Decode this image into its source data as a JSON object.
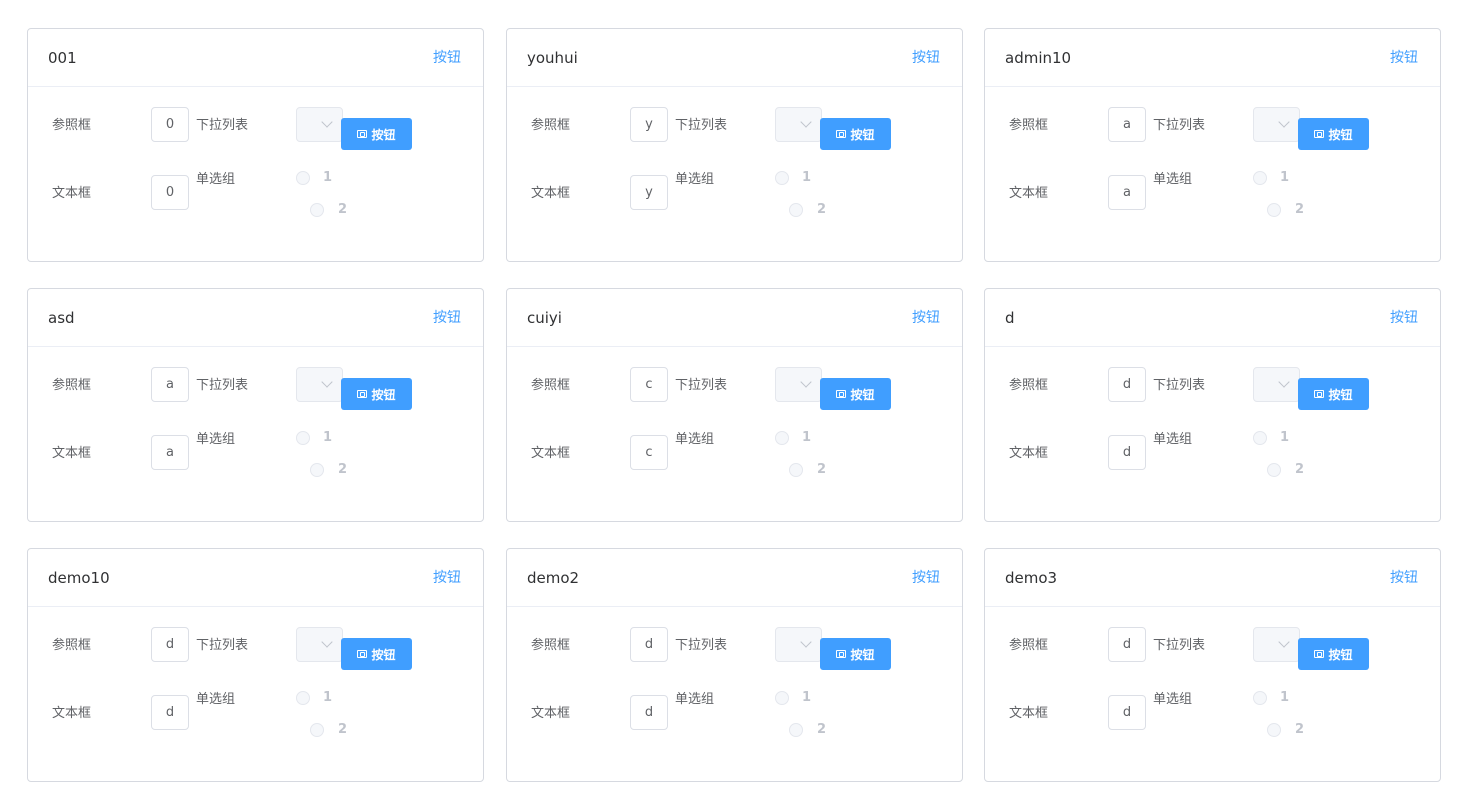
{
  "colors": {
    "accent": "#409eff",
    "border": "#d6d9e0",
    "muted": "#c0c4cc"
  },
  "cards": [
    {
      "title": "001",
      "header_button": "按钮",
      "ref_label": "参照框",
      "ref_value": "0",
      "select_label": "下拉列表",
      "select_value": "",
      "action_button": "按钮",
      "text_label": "文本框",
      "text_value": "0",
      "radio_label": "单选组",
      "radio_options": [
        "1",
        "2"
      ]
    },
    {
      "title": "youhui",
      "header_button": "按钮",
      "ref_label": "参照框",
      "ref_value": "y",
      "select_label": "下拉列表",
      "select_value": "",
      "action_button": "按钮",
      "text_label": "文本框",
      "text_value": "y",
      "radio_label": "单选组",
      "radio_options": [
        "1",
        "2"
      ]
    },
    {
      "title": "admin10",
      "header_button": "按钮",
      "ref_label": "参照框",
      "ref_value": "a",
      "select_label": "下拉列表",
      "select_value": "",
      "action_button": "按钮",
      "text_label": "文本框",
      "text_value": "a",
      "radio_label": "单选组",
      "radio_options": [
        "1",
        "2"
      ]
    },
    {
      "title": "asd",
      "header_button": "按钮",
      "ref_label": "参照框",
      "ref_value": "a",
      "select_label": "下拉列表",
      "select_value": "",
      "action_button": "按钮",
      "text_label": "文本框",
      "text_value": "a",
      "radio_label": "单选组",
      "radio_options": [
        "1",
        "2"
      ]
    },
    {
      "title": "cuiyi",
      "header_button": "按钮",
      "ref_label": "参照框",
      "ref_value": "c",
      "select_label": "下拉列表",
      "select_value": "",
      "action_button": "按钮",
      "text_label": "文本框",
      "text_value": "c",
      "radio_label": "单选组",
      "radio_options": [
        "1",
        "2"
      ]
    },
    {
      "title": "d",
      "header_button": "按钮",
      "ref_label": "参照框",
      "ref_value": "d",
      "select_label": "下拉列表",
      "select_value": "",
      "action_button": "按钮",
      "text_label": "文本框",
      "text_value": "d",
      "radio_label": "单选组",
      "radio_options": [
        "1",
        "2"
      ]
    },
    {
      "title": "demo10",
      "header_button": "按钮",
      "ref_label": "参照框",
      "ref_value": "d",
      "select_label": "下拉列表",
      "select_value": "",
      "action_button": "按钮",
      "text_label": "文本框",
      "text_value": "d",
      "radio_label": "单选组",
      "radio_options": [
        "1",
        "2"
      ]
    },
    {
      "title": "demo2",
      "header_button": "按钮",
      "ref_label": "参照框",
      "ref_value": "d",
      "select_label": "下拉列表",
      "select_value": "",
      "action_button": "按钮",
      "text_label": "文本框",
      "text_value": "d",
      "radio_label": "单选组",
      "radio_options": [
        "1",
        "2"
      ]
    },
    {
      "title": "demo3",
      "header_button": "按钮",
      "ref_label": "参照框",
      "ref_value": "d",
      "select_label": "下拉列表",
      "select_value": "",
      "action_button": "按钮",
      "text_label": "文本框",
      "text_value": "d",
      "radio_label": "单选组",
      "radio_options": [
        "1",
        "2"
      ]
    }
  ]
}
